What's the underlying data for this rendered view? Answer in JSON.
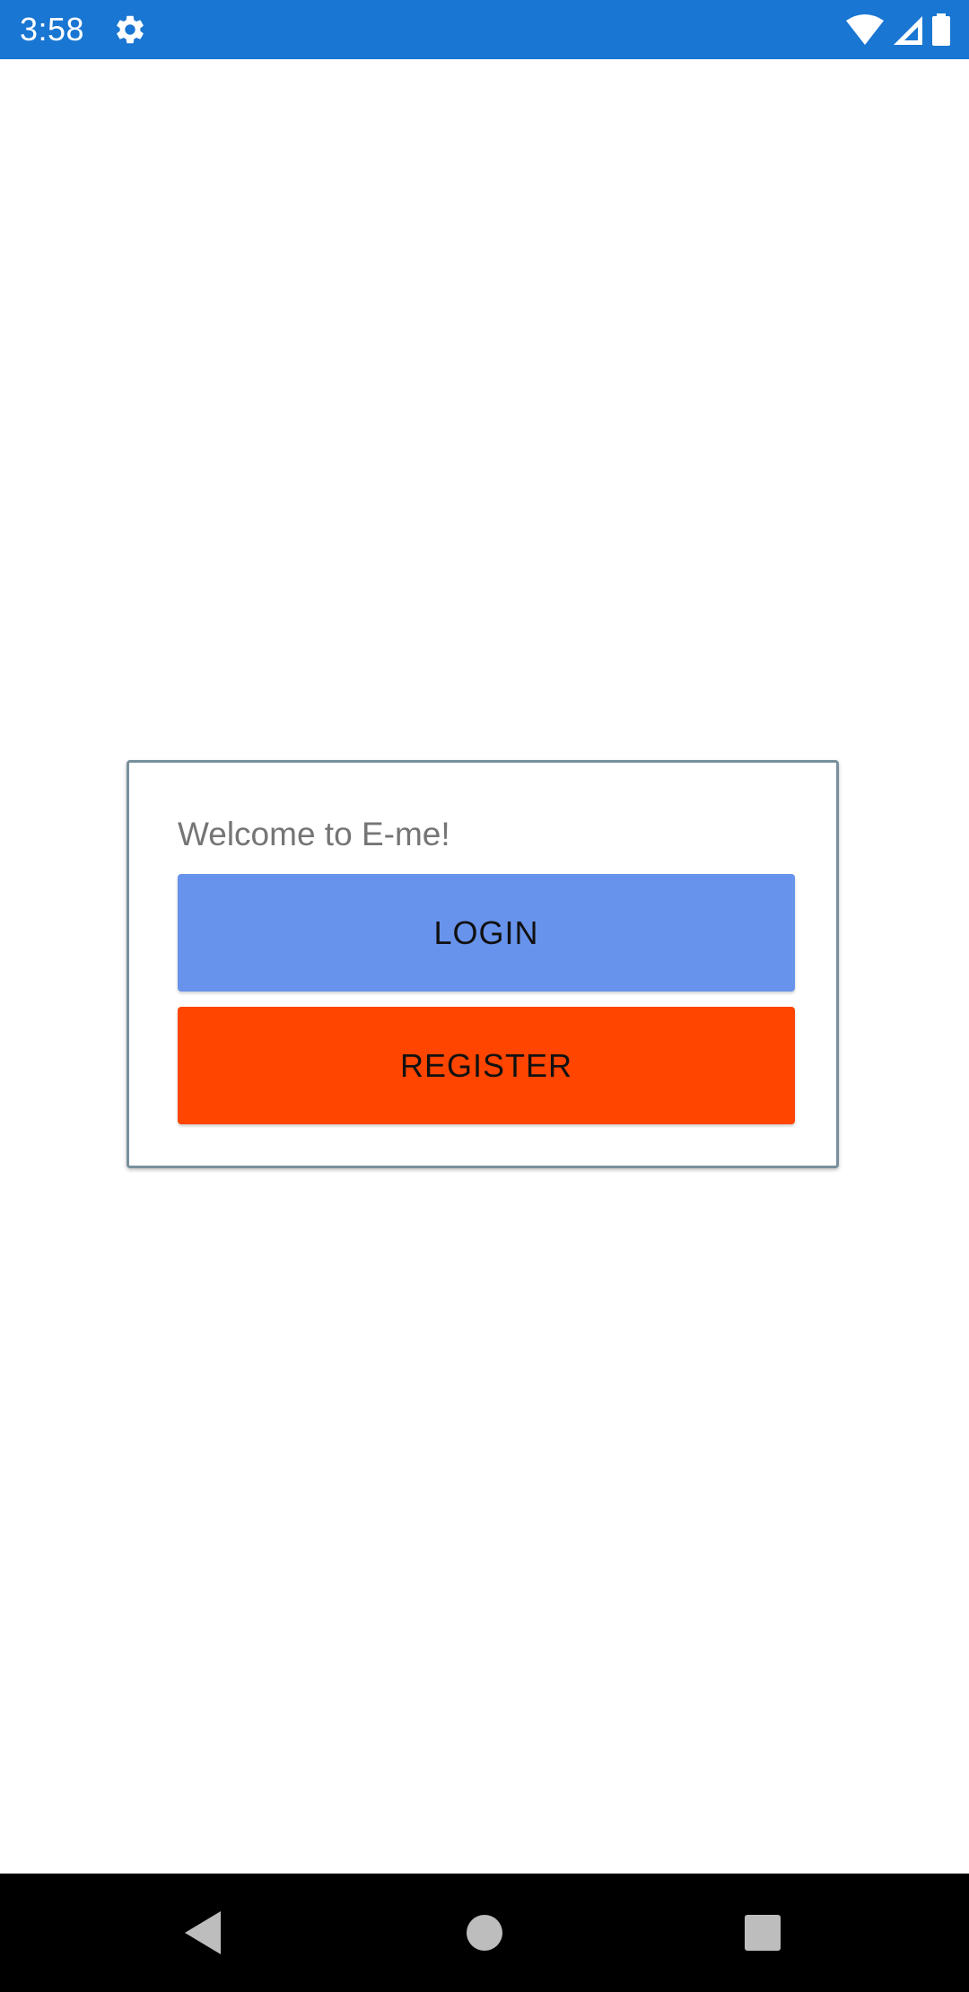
{
  "status_bar": {
    "time": "3:58",
    "background_color": "#1976D2",
    "icons": [
      "gear-icon",
      "wifi-icon",
      "signal-icon",
      "battery-icon"
    ]
  },
  "welcome_card": {
    "message": "Welcome to E-me!",
    "border_color": "#78909C",
    "login_button": {
      "label": "LOGIN",
      "color": "#6893EC"
    },
    "register_button": {
      "label": "REGISTER",
      "color": "#FF4500"
    }
  },
  "nav_bar": {
    "icons": [
      "back-icon",
      "home-icon",
      "recents-icon"
    ]
  }
}
